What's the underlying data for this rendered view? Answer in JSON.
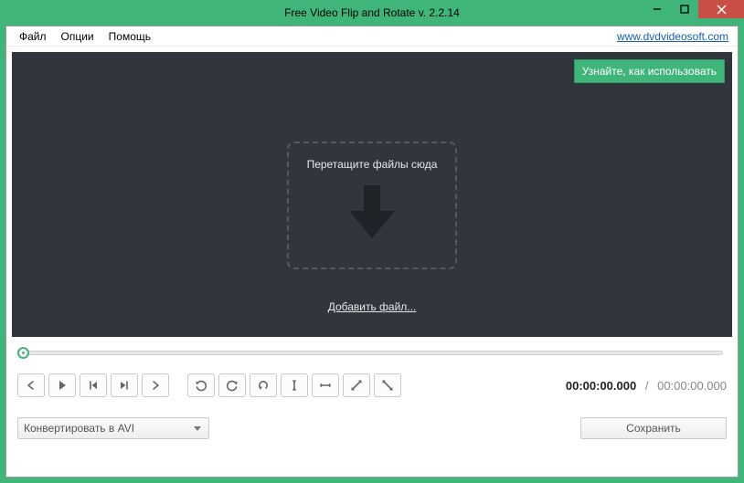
{
  "title": "Free Video Flip and Rotate v. 2.2.14",
  "menu": {
    "file": "Файл",
    "options": "Опции",
    "help": "Помощь"
  },
  "site_link": "www.dvdvideosoft.com",
  "learn_button": "Узнайте, как использовать",
  "dropzone_text": "Перетащите файлы сюда",
  "add_file": "Добавить файл...",
  "time": {
    "current": "00:00:00.000",
    "total": "00:00:00.000",
    "sep": "/"
  },
  "format_select": "Конвертировать в AVI",
  "save_button": "Сохранить"
}
